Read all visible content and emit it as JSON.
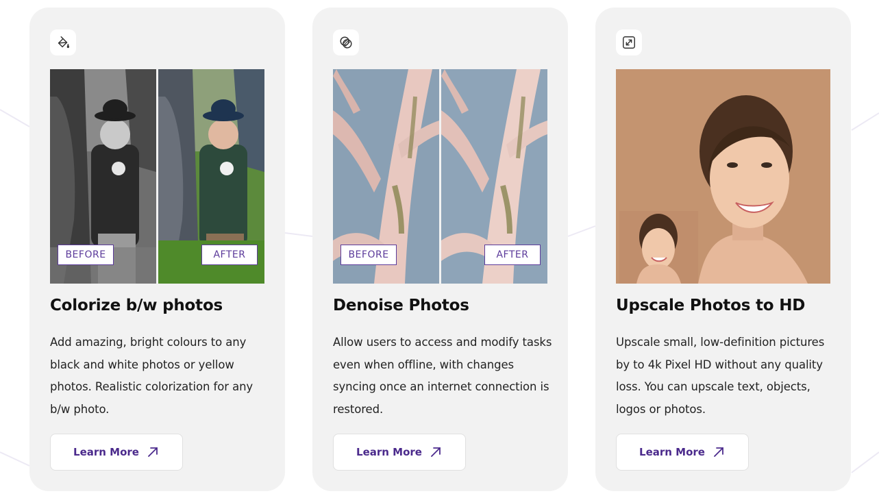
{
  "accent_color": "#4b2a8c",
  "cards": [
    {
      "icon": "paint-bucket-icon",
      "title": "Colorize b/w photos",
      "description": "Add amazing, bright colours to any black and white photos or yellow photos. Realistic colorization for any b/w photo.",
      "before_label": "BEFORE",
      "after_label": "AFTER",
      "button_label": "Learn More",
      "button_icon": "arrow-up-right-icon"
    },
    {
      "icon": "overlapping-circles-icon",
      "title": "Denoise Photos",
      "description": "Allow users to access and modify tasks even when offline, with changes syncing once an internet connection is restored.",
      "before_label": "BEFORE",
      "after_label": "AFTER",
      "button_label": "Learn More",
      "button_icon": "arrow-up-right-icon"
    },
    {
      "icon": "expand-icon",
      "title": "Upscale Photos to HD",
      "description": "Upscale small, low-definition pictures by to 4k Pixel HD without any quality loss. You can upscale text, objects, logos or photos.",
      "button_label": "Learn More",
      "button_icon": "arrow-up-right-icon"
    }
  ]
}
